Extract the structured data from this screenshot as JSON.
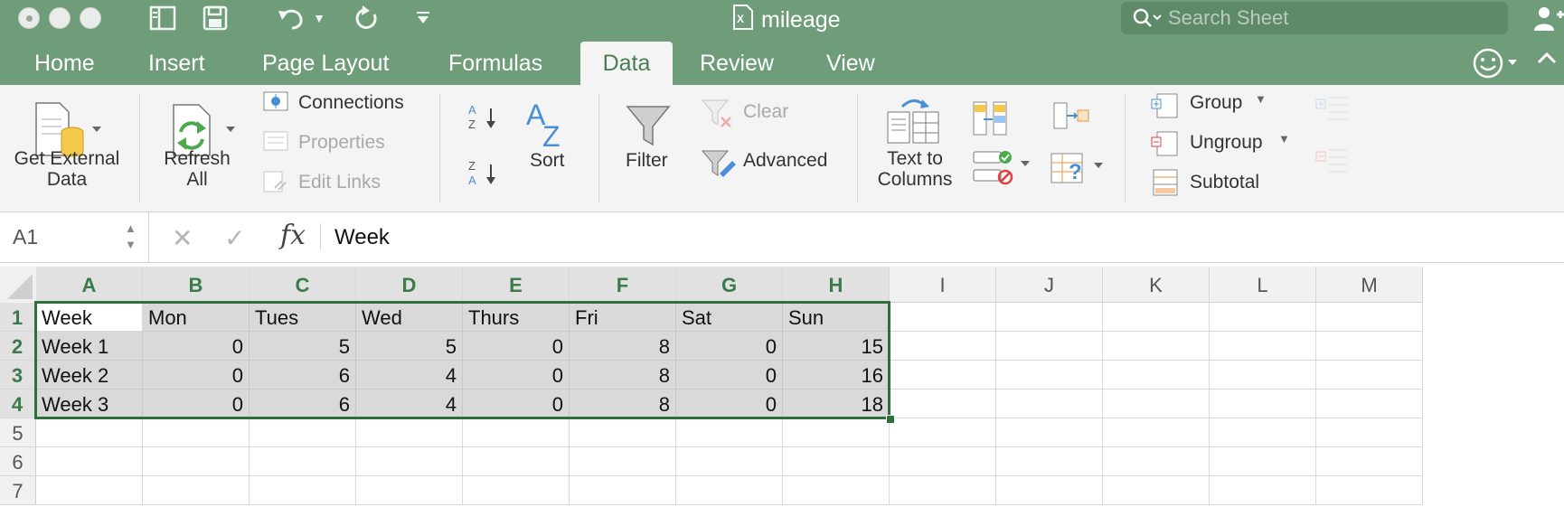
{
  "window": {
    "title": "mileage",
    "search_placeholder": "Search Sheet"
  },
  "tabs": [
    {
      "label": "Home"
    },
    {
      "label": "Insert"
    },
    {
      "label": "Page Layout"
    },
    {
      "label": "Formulas"
    },
    {
      "label": "Data",
      "active": true
    },
    {
      "label": "Review"
    },
    {
      "label": "View"
    }
  ],
  "ribbon": {
    "get_external_data": [
      "Get External",
      "Data"
    ],
    "refresh_all": [
      "Refresh",
      "All"
    ],
    "connections": "Connections",
    "properties": "Properties",
    "edit_links": "Edit Links",
    "sort": "Sort",
    "filter": "Filter",
    "clear": "Clear",
    "advanced": "Advanced",
    "text_to_columns": [
      "Text to",
      "Columns"
    ],
    "group": "Group",
    "ungroup": "Ungroup",
    "subtotal": "Subtotal"
  },
  "formula_bar": {
    "name_box": "A1",
    "fx_label": "fx",
    "content": "Week"
  },
  "sheet": {
    "columns": [
      "A",
      "B",
      "C",
      "D",
      "E",
      "F",
      "G",
      "H",
      "I",
      "J",
      "K",
      "L",
      "M"
    ],
    "rows": [
      "1",
      "2",
      "3",
      "4",
      "5",
      "6",
      "7"
    ],
    "selected_range": "A1:H4",
    "cells": [
      [
        "Week",
        "Mon",
        "Tues",
        "Wed",
        "Thurs",
        "Fri",
        "Sat",
        "Sun"
      ],
      [
        "Week 1",
        "0",
        "5",
        "5",
        "0",
        "8",
        "0",
        "15"
      ],
      [
        "Week 2",
        "0",
        "6",
        "4",
        "0",
        "8",
        "0",
        "16"
      ],
      [
        "Week 3",
        "0",
        "6",
        "4",
        "0",
        "8",
        "0",
        "18"
      ]
    ]
  },
  "colors": {
    "accent": "#6f9c79",
    "selection_border": "#2f6e3d"
  }
}
